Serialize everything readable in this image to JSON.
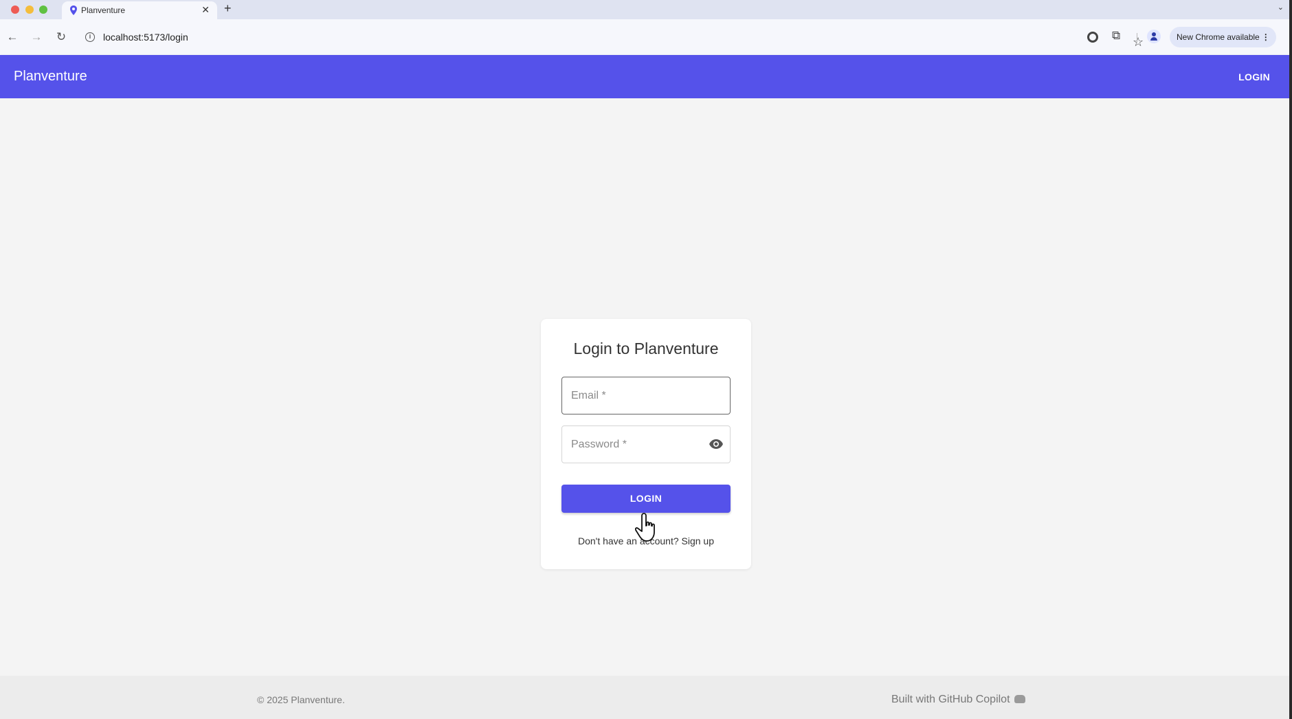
{
  "browser": {
    "tab_title": "Planventure",
    "tab_close": "✕",
    "new_tab": "+",
    "tabs_menu": "⌄",
    "url": "localhost:5173/login",
    "update_chip": "New Chrome available",
    "update_menu": "⋮",
    "back": "←",
    "forward": "→",
    "reload": "↻",
    "info": "i",
    "bookmark": "☆",
    "extensions": "⧉"
  },
  "appbar": {
    "brand": "Planventure",
    "login_link": "LOGIN",
    "color": "#5552ea"
  },
  "login_card": {
    "title": "Login to Planventure",
    "email_label": "Email *",
    "password_label": "Password *",
    "login_button": "LOGIN",
    "signup_prompt": "Don't have an account? Sign up"
  },
  "footer": {
    "copyright": "© 2025 Planventure.",
    "built_with": "Built with GitHub Copilot"
  }
}
